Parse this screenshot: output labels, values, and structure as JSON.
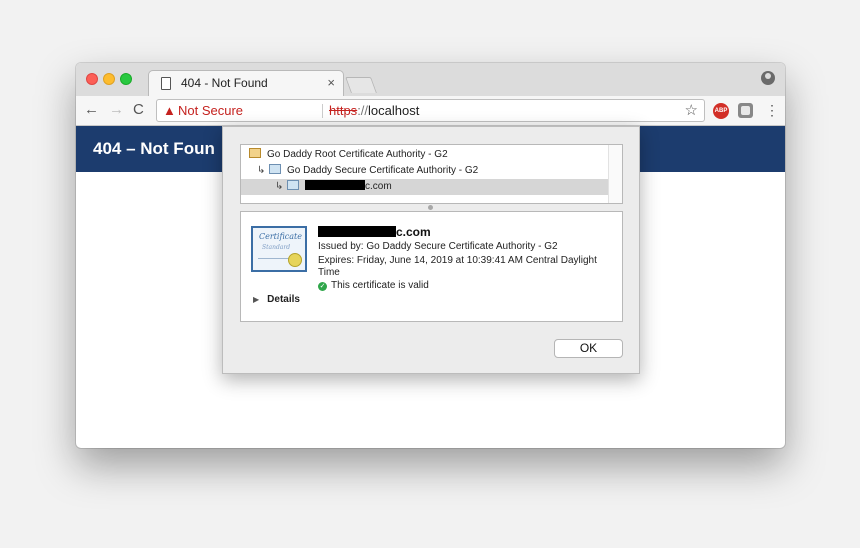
{
  "browser": {
    "tab": {
      "title": "404 - Not Found",
      "close": "×"
    },
    "toolbar": {
      "back": "←",
      "forward": "→",
      "reload": "C",
      "security_label": "Not Secure",
      "url_scheme": "https",
      "url_sep": "://",
      "url_host": "localhost",
      "bookmark": "☆",
      "adblock": "ABP",
      "menu": "⋮"
    }
  },
  "page": {
    "heading": "404 – Not Foun"
  },
  "cert_dialog": {
    "chain": [
      {
        "label": "Go Daddy Root Certificate Authority - G2"
      },
      {
        "label": "Go Daddy Secure Certificate Authority - G2"
      },
      {
        "label_suffix": "c.com"
      }
    ],
    "subject_suffix": "c.com",
    "issued_by": "Issued by: Go Daddy Secure Certificate Authority - G2",
    "expires_line1": "Expires: Friday, June 14, 2019 at 10:39:41 AM Central Daylight",
    "expires_line2": "Time",
    "status": "This certificate is valid",
    "details_label": "Details",
    "ok_label": "OK",
    "cert_image_text": {
      "title": "Certificate",
      "subtitle": "Standard"
    }
  }
}
